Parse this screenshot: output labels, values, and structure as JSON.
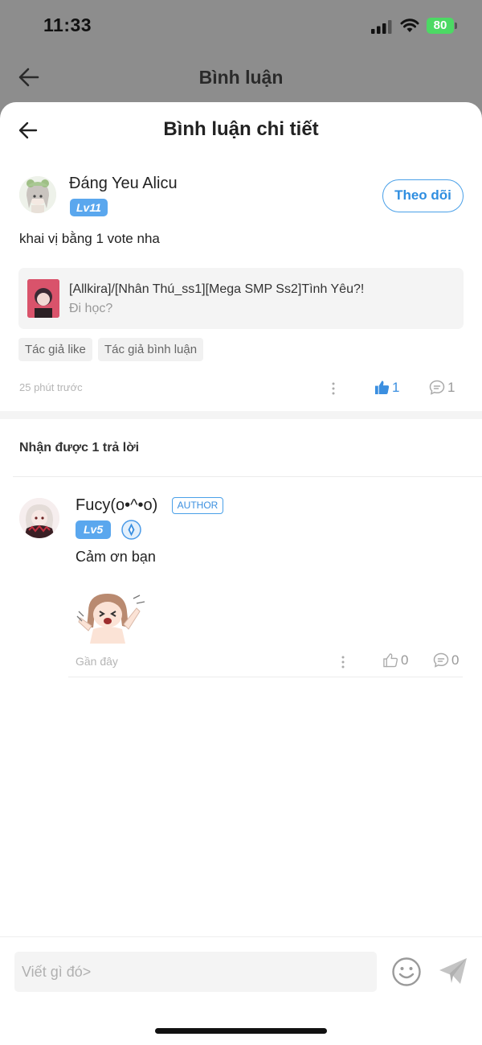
{
  "status_bar": {
    "time": "11:33",
    "battery": "80"
  },
  "background_screen": {
    "title": "Bình luận"
  },
  "sheet": {
    "title": "Bình luận chi tiết"
  },
  "main_comment": {
    "author": "Đáng Yeu Alicu",
    "level": "Lv11",
    "follow_label": "Theo dõi",
    "text": "khai vị bằng 1 vote nha",
    "story": {
      "title": "[Allkira]/[Nhân Thú_ss1][Mega SMP Ss2]Tình Yêu?!",
      "subtitle": "Đi học?"
    },
    "tags": [
      "Tác giả like",
      "Tác giả bình luận"
    ],
    "time": "25 phút trước",
    "likes": "1",
    "comments": "1"
  },
  "replies_header": "Nhận được 1 trả lời",
  "reply": {
    "author": "Fucy(o•^•o)",
    "author_badge": "AUTHOR",
    "level": "Lv5",
    "text": "Cảm ơn bạn",
    "time": "Gần đây",
    "likes": "0",
    "comments": "0"
  },
  "input": {
    "placeholder": "Viết gì đó>"
  },
  "colors": {
    "accent": "#3b8fe0",
    "level_badge": "#5aa7ee",
    "battery": "#4cd964"
  },
  "icons": [
    "back-arrow-icon",
    "cellular-signal-icon",
    "wifi-icon",
    "battery-icon",
    "more-vertical-icon",
    "thumbs-up-icon",
    "comment-bubble-icon",
    "verified-badge-icon",
    "emoji-icon",
    "send-icon"
  ]
}
